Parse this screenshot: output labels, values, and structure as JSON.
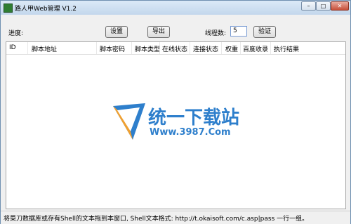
{
  "window": {
    "title": "路人甲Web管理 V1.2",
    "min_label": "–",
    "max_label": "□",
    "close_label": "✕"
  },
  "toolbar": {
    "progress_label": "进度:",
    "settings_label": "设置",
    "export_label": "导出",
    "threads_label": "线程数:",
    "threads_value": "5",
    "verify_label": "验证"
  },
  "table": {
    "columns": [
      "ID",
      "脚本地址",
      "脚本密码",
      "脚本类型",
      "在线状态",
      "连接状态",
      "权重",
      "百度收录",
      "执行结果"
    ]
  },
  "watermark": {
    "line1": "统一下载站",
    "line2": "Www.3987.Com"
  },
  "status": {
    "text": "将菜刀数据库或存有Shell的文本拖到本窗口, Shell文本格式: http://t.okaisoft.com/c.asp|pass 一行一组。"
  },
  "colors": {
    "watermark_blue": "#2e7fcc",
    "watermark_orange": "#f0a030"
  }
}
